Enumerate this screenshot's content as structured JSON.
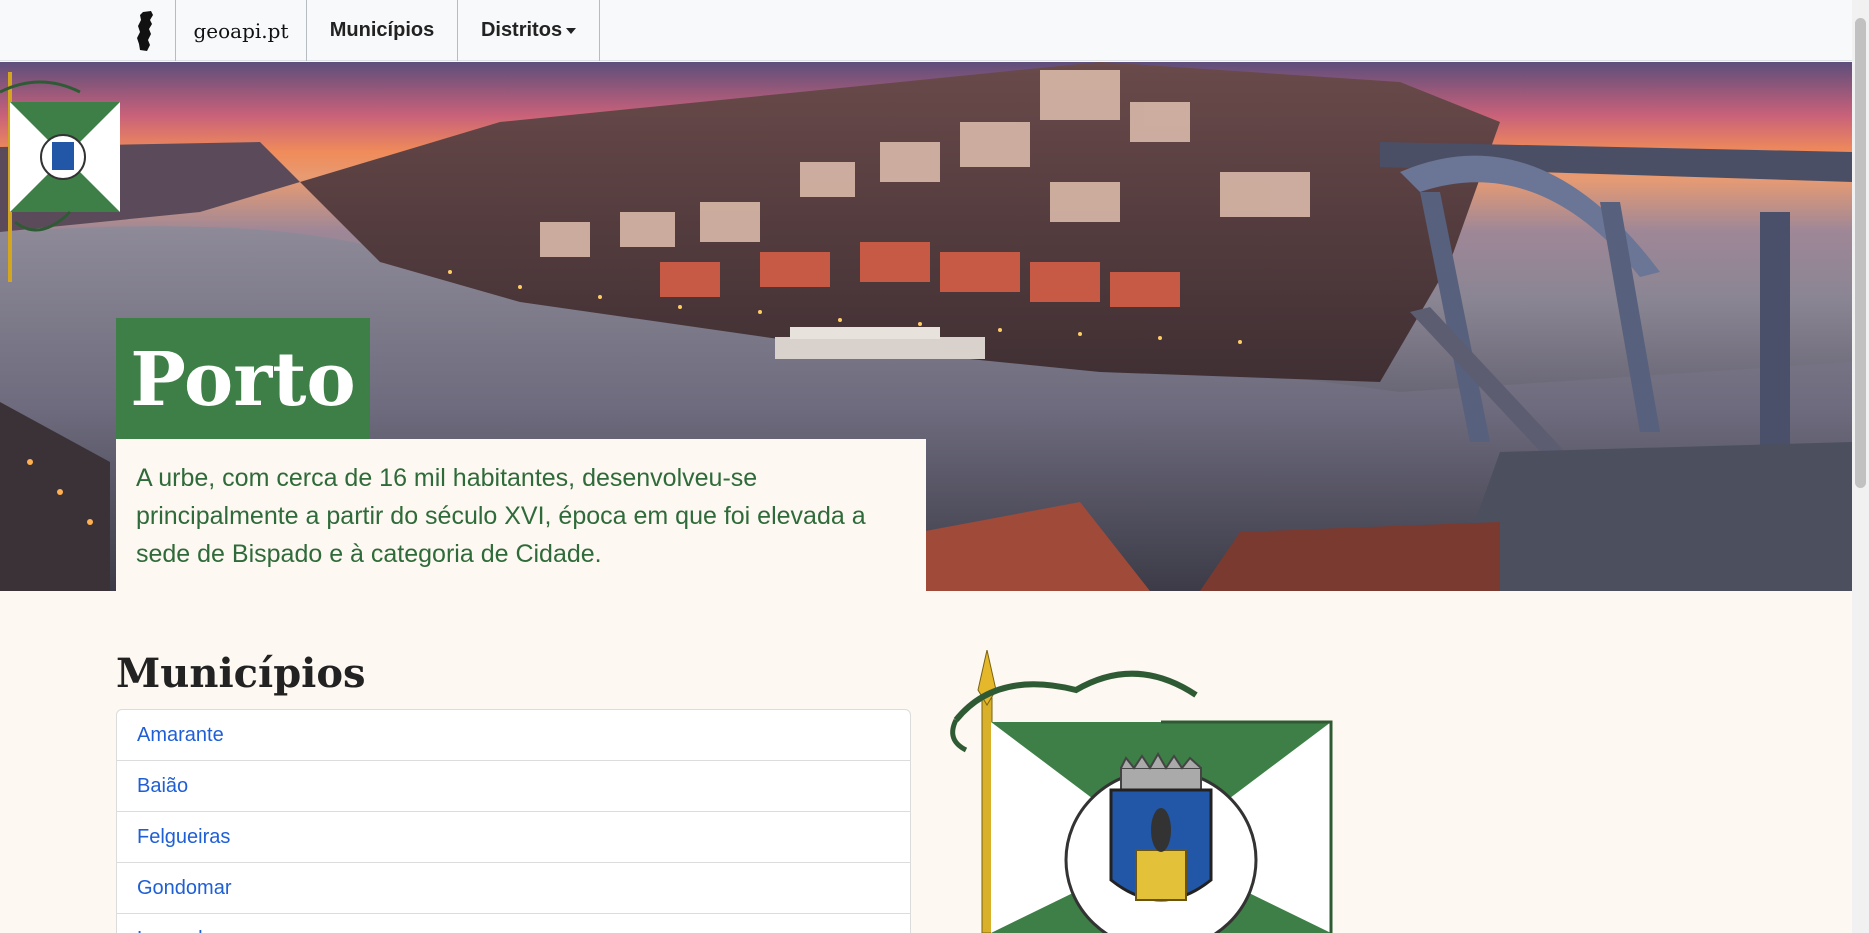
{
  "navbar": {
    "logo_icon": "portugal-map-icon",
    "brand": "geoapi.pt",
    "municipios": "Municípios",
    "distritos": "Distritos"
  },
  "hero": {
    "title": "Porto",
    "description": "A urbe, com cerca de 16 mil habitantes, desenvolveu-se principalmente a partir do século XVI, época em que foi elevada a sede de Bispado e à categoria de Cidade."
  },
  "main": {
    "section_title": "Municípios",
    "municipios": [
      "Amarante",
      "Baião",
      "Felgueiras",
      "Gondomar",
      "Lousada"
    ]
  },
  "colors": {
    "accent_green": "#3d7f46",
    "link_blue": "#1f5fd6",
    "page_bg": "#fdf8f1"
  }
}
